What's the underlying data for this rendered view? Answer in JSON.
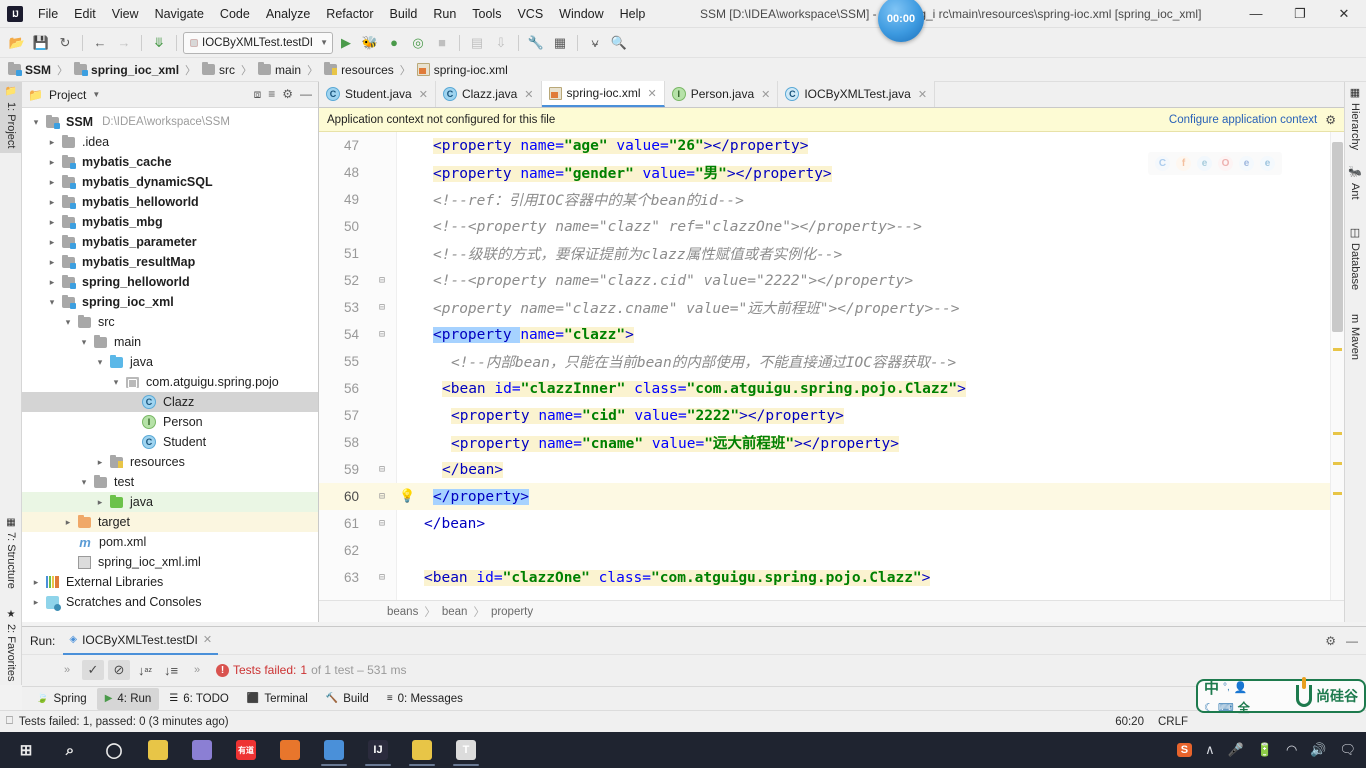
{
  "titlebar": {
    "app_icon": "intellij-idea-logo",
    "title": "SSM [D:\\IDEA\\workspace\\SSM] - ...\\spring_i     rc\\main\\resources\\spring-ioc.xml [spring_ioc_xml]",
    "timer_badge": "00:00",
    "menus": [
      "File",
      "Edit",
      "View",
      "Navigate",
      "Code",
      "Analyze",
      "Refactor",
      "Build",
      "Run",
      "Tools",
      "VCS",
      "Window",
      "Help"
    ],
    "window_buttons": {
      "minimize": "—",
      "maximize": "❐",
      "close": "✕"
    }
  },
  "toolbar": {
    "run_config": "IOCByXMLTest.testDI",
    "icons": [
      "open-folder-icon",
      "save-icon",
      "sync-icon",
      "back-arrow-icon",
      "forward-arrow-icon",
      "undo-icon",
      "run-icon",
      "debug-icon",
      "run-coverage-icon",
      "profile-icon",
      "stop-icon",
      "build-icon",
      "build-download-icon",
      "settings-wrench-icon",
      "project-structure-icon",
      "terminal-icon",
      "search-icon"
    ]
  },
  "navbar": {
    "crumbs": [
      {
        "label": "SSM",
        "icon": "module-folder-icon",
        "bold": true
      },
      {
        "label": "spring_ioc_xml",
        "icon": "module-folder-icon",
        "bold": true
      },
      {
        "label": "src",
        "icon": "folder-icon",
        "bold": false
      },
      {
        "label": "main",
        "icon": "folder-icon",
        "bold": false
      },
      {
        "label": "resources",
        "icon": "resources-folder-icon",
        "bold": false
      },
      {
        "label": "spring-ioc.xml",
        "icon": "xml-file-icon",
        "bold": false
      }
    ]
  },
  "left_strip": {
    "tabs": [
      {
        "label": "1: Project",
        "icon": "project-icon",
        "active": true
      },
      {
        "label": "7: Structure",
        "icon": "structure-icon",
        "active": false
      },
      {
        "label": "2: Favorites",
        "icon": "star-icon",
        "active": false
      }
    ]
  },
  "right_strip": {
    "tabs": [
      {
        "label": "Hierarchy",
        "icon": "hierarchy-icon"
      },
      {
        "label": "Ant",
        "icon": "ant-icon"
      },
      {
        "label": "Database",
        "icon": "database-icon"
      },
      {
        "label": "Maven",
        "icon": "maven-icon"
      }
    ]
  },
  "project_panel": {
    "title": "Project",
    "header_icons": [
      "collapse-all-icon",
      "expand-icon",
      "settings-gear-icon",
      "hide-icon"
    ],
    "tree": [
      {
        "label": "SSM",
        "path": "D:\\IDEA\\workspace\\SSM",
        "indent": 0,
        "arrow": "down",
        "icon": "module-folder-icon",
        "bold": true,
        "state": ""
      },
      {
        "label": ".idea",
        "indent": 1,
        "arrow": "right",
        "icon": "folder-icon",
        "bold": false,
        "state": ""
      },
      {
        "label": "mybatis_cache",
        "indent": 1,
        "arrow": "right",
        "icon": "module-folder-icon",
        "bold": true,
        "state": ""
      },
      {
        "label": "mybatis_dynamicSQL",
        "indent": 1,
        "arrow": "right",
        "icon": "module-folder-icon",
        "bold": true,
        "state": ""
      },
      {
        "label": "mybatis_helloworld",
        "indent": 1,
        "arrow": "right",
        "icon": "module-folder-icon",
        "bold": true,
        "state": ""
      },
      {
        "label": "mybatis_mbg",
        "indent": 1,
        "arrow": "right",
        "icon": "module-folder-icon",
        "bold": true,
        "state": ""
      },
      {
        "label": "mybatis_parameter",
        "indent": 1,
        "arrow": "right",
        "icon": "module-folder-icon",
        "bold": true,
        "state": ""
      },
      {
        "label": "mybatis_resultMap",
        "indent": 1,
        "arrow": "right",
        "icon": "module-folder-icon",
        "bold": true,
        "state": ""
      },
      {
        "label": "spring_helloworld",
        "indent": 1,
        "arrow": "right",
        "icon": "module-folder-icon",
        "bold": true,
        "state": ""
      },
      {
        "label": "spring_ioc_xml",
        "indent": 1,
        "arrow": "down",
        "icon": "module-folder-icon",
        "bold": true,
        "state": ""
      },
      {
        "label": "src",
        "indent": 2,
        "arrow": "down",
        "icon": "folder-icon",
        "bold": false,
        "state": ""
      },
      {
        "label": "main",
        "indent": 3,
        "arrow": "down",
        "icon": "folder-icon",
        "bold": false,
        "state": ""
      },
      {
        "label": "java",
        "indent": 4,
        "arrow": "down",
        "icon": "source-folder-icon",
        "bold": false,
        "state": ""
      },
      {
        "label": "com.atguigu.spring.pojo",
        "indent": 5,
        "arrow": "down",
        "icon": "package-icon",
        "bold": false,
        "state": ""
      },
      {
        "label": "Clazz",
        "indent": 6,
        "arrow": "none",
        "icon": "java-class-icon",
        "bold": false,
        "state": "selected"
      },
      {
        "label": "Person",
        "indent": 6,
        "arrow": "none",
        "icon": "java-interface-icon",
        "bold": false,
        "state": ""
      },
      {
        "label": "Student",
        "indent": 6,
        "arrow": "none",
        "icon": "java-class-icon",
        "bold": false,
        "state": ""
      },
      {
        "label": "resources",
        "indent": 4,
        "arrow": "right",
        "icon": "resources-folder-icon",
        "bold": false,
        "state": ""
      },
      {
        "label": "test",
        "indent": 3,
        "arrow": "down",
        "icon": "folder-icon",
        "bold": false,
        "state": ""
      },
      {
        "label": "java",
        "indent": 4,
        "arrow": "right",
        "icon": "test-source-folder-icon",
        "bold": false,
        "state": "green"
      },
      {
        "label": "target",
        "indent": 2,
        "arrow": "right",
        "icon": "target-folder-icon",
        "bold": false,
        "state": "yellow"
      },
      {
        "label": "pom.xml",
        "indent": 2,
        "arrow": "none",
        "icon": "maven-pom-icon",
        "bold": false,
        "state": ""
      },
      {
        "label": "spring_ioc_xml.iml",
        "indent": 2,
        "arrow": "none",
        "icon": "iml-file-icon",
        "bold": false,
        "state": ""
      },
      {
        "label": "External Libraries",
        "indent": 0,
        "arrow": "right",
        "icon": "libraries-icon",
        "bold": false,
        "state": ""
      },
      {
        "label": "Scratches and Consoles",
        "indent": 0,
        "arrow": "right",
        "icon": "scratches-icon",
        "bold": false,
        "state": ""
      }
    ]
  },
  "editor": {
    "tabs": [
      {
        "label": "Student.java",
        "icon": "java-class-icon",
        "active": false
      },
      {
        "label": "Clazz.java",
        "icon": "java-class-icon",
        "active": false
      },
      {
        "label": "spring-ioc.xml",
        "icon": "spring-xml-icon",
        "active": true
      },
      {
        "label": "Person.java",
        "icon": "java-interface-icon",
        "active": false
      },
      {
        "label": "IOCByXMLTest.java",
        "icon": "java-test-class-icon",
        "active": false
      }
    ],
    "notification": {
      "message": "Application context not configured for this file",
      "link": "Configure application context",
      "gear": "gear-icon"
    },
    "browser_previews": [
      "chrome-icon",
      "firefox-icon",
      "explorer-icon",
      "opera-icon",
      "edge-legacy-icon",
      "edge-icon"
    ],
    "breadcrumb": [
      "beans",
      "bean",
      "property"
    ],
    "current_line": 60,
    "lines": [
      {
        "n": 47,
        "fold": "",
        "cur": false,
        "indent": 4,
        "parts": [
          {
            "t": "<property ",
            "c": "tg",
            "h": true
          },
          {
            "t": "name=",
            "c": "at",
            "h": true
          },
          {
            "t": "\"age\"",
            "c": "vl",
            "h": true
          },
          {
            "t": " ",
            "c": "tg",
            "h": true
          },
          {
            "t": "value=",
            "c": "at",
            "h": true
          },
          {
            "t": "\"26\"",
            "c": "vl",
            "h": true
          },
          {
            "t": "></property>",
            "c": "tg",
            "h": true
          }
        ]
      },
      {
        "n": 48,
        "fold": "",
        "cur": false,
        "indent": 4,
        "parts": [
          {
            "t": "<property ",
            "c": "tg",
            "h": true
          },
          {
            "t": "name=",
            "c": "at",
            "h": true
          },
          {
            "t": "\"gender\"",
            "c": "vl",
            "h": true
          },
          {
            "t": " ",
            "c": "tg",
            "h": true
          },
          {
            "t": "value=",
            "c": "at",
            "h": true
          },
          {
            "t": "\"男\"",
            "c": "vl",
            "h": true
          },
          {
            "t": "></property>",
            "c": "tg",
            "h": true
          }
        ]
      },
      {
        "n": 49,
        "fold": "",
        "cur": false,
        "indent": 4,
        "parts": [
          {
            "t": "<!--ref：引用IOC容器中的某个bean的id-->",
            "c": "cm",
            "h": false
          }
        ]
      },
      {
        "n": 50,
        "fold": "",
        "cur": false,
        "indent": 4,
        "parts": [
          {
            "t": "<!--<property name=\"clazz\" ref=\"clazzOne\"></property>-->",
            "c": "cm",
            "h": false
          }
        ]
      },
      {
        "n": 51,
        "fold": "",
        "cur": false,
        "indent": 4,
        "parts": [
          {
            "t": "<!--级联的方式，要保证提前为clazz属性赋值或者实例化-->",
            "c": "cm",
            "h": false
          }
        ]
      },
      {
        "n": 52,
        "fold": "minus",
        "cur": false,
        "indent": 4,
        "parts": [
          {
            "t": "<!--<property name=\"clazz.cid\" value=\"2222\"></property>",
            "c": "cm",
            "h": false
          }
        ]
      },
      {
        "n": 53,
        "fold": "minus",
        "cur": false,
        "indent": 4,
        "parts": [
          {
            "t": "<property name=\"clazz.cname\" value=\"远大前程班\"></property>-->",
            "c": "cm",
            "h": false
          }
        ]
      },
      {
        "n": 54,
        "fold": "minus",
        "cur": false,
        "indent": 4,
        "parts": [
          {
            "t": "<property ",
            "c": "tg",
            "sel": true
          },
          {
            "t": "name=",
            "c": "at",
            "h": true
          },
          {
            "t": "\"clazz\"",
            "c": "vl",
            "h": true
          },
          {
            "t": ">",
            "c": "tg",
            "h": true
          }
        ]
      },
      {
        "n": 55,
        "fold": "",
        "cur": false,
        "indent": 6,
        "parts": [
          {
            "t": "<!--内部bean，只能在当前bean的内部使用，不能直接通过IOC容器获取-->",
            "c": "cm",
            "h": false
          }
        ]
      },
      {
        "n": 56,
        "fold": "",
        "cur": false,
        "indent": 5,
        "parts": [
          {
            "t": "<bean ",
            "c": "tg",
            "h": true
          },
          {
            "t": "id=",
            "c": "at",
            "h": true
          },
          {
            "t": "\"clazzInner\"",
            "c": "vl",
            "h": true
          },
          {
            "t": " ",
            "c": "tg",
            "h": true
          },
          {
            "t": "class=",
            "c": "at",
            "h": true
          },
          {
            "t": "\"com.atguigu.spring.pojo.Clazz\"",
            "c": "vl",
            "h": true
          },
          {
            "t": ">",
            "c": "tg",
            "h": true
          }
        ]
      },
      {
        "n": 57,
        "fold": "",
        "cur": false,
        "indent": 6,
        "parts": [
          {
            "t": "<property ",
            "c": "tg",
            "h": true
          },
          {
            "t": "name=",
            "c": "at",
            "h": true
          },
          {
            "t": "\"cid\"",
            "c": "vl",
            "h": true
          },
          {
            "t": " ",
            "c": "tg",
            "h": true
          },
          {
            "t": "value=",
            "c": "at",
            "h": true
          },
          {
            "t": "\"2222\"",
            "c": "vl",
            "h": true
          },
          {
            "t": "></property>",
            "c": "tg",
            "h": true
          }
        ]
      },
      {
        "n": 58,
        "fold": "",
        "cur": false,
        "indent": 6,
        "parts": [
          {
            "t": "<property ",
            "c": "tg",
            "h": true
          },
          {
            "t": "name=",
            "c": "at",
            "h": true
          },
          {
            "t": "\"cname\"",
            "c": "vl",
            "h": true
          },
          {
            "t": " ",
            "c": "tg",
            "h": true
          },
          {
            "t": "value=",
            "c": "at",
            "h": true
          },
          {
            "t": "\"远大前程班\"",
            "c": "vl",
            "h": true
          },
          {
            "t": "></property>",
            "c": "tg",
            "h": true
          }
        ]
      },
      {
        "n": 59,
        "fold": "minus",
        "cur": false,
        "indent": 5,
        "parts": [
          {
            "t": "</bean>",
            "c": "tg",
            "h": true
          }
        ]
      },
      {
        "n": 60,
        "fold": "minus",
        "cur": true,
        "indent": 4,
        "bulb": true,
        "parts": [
          {
            "t": "</property>",
            "c": "tg",
            "sel": true
          }
        ]
      },
      {
        "n": 61,
        "fold": "minus",
        "cur": false,
        "indent": 3,
        "parts": [
          {
            "t": "</bean>",
            "c": "tg",
            "h": false
          }
        ]
      },
      {
        "n": 62,
        "fold": "",
        "cur": false,
        "indent": 0,
        "parts": []
      },
      {
        "n": 63,
        "fold": "minus",
        "cur": false,
        "indent": 3,
        "parts": [
          {
            "t": "<bean ",
            "c": "tg",
            "h": true
          },
          {
            "t": "id=",
            "c": "at",
            "h": true
          },
          {
            "t": "\"clazzOne\"",
            "c": "vl",
            "h": true
          },
          {
            "t": " ",
            "c": "tg",
            "h": true
          },
          {
            "t": "class=",
            "c": "at",
            "h": true
          },
          {
            "t": "\"com.atguigu.spring.pojo.Clazz\"",
            "c": "vl",
            "h": true
          },
          {
            "t": ">",
            "c": "tg",
            "h": true
          }
        ]
      }
    ]
  },
  "run_panel": {
    "label": "Run:",
    "tab": "IOCByXMLTest.testDI",
    "toolbar_icons": [
      "show-passed-icon",
      "hide-ignored-icon",
      "sort-alphabetically-icon",
      "sort-by-duration-icon",
      "expand-more-icon"
    ],
    "status_prefix": "Tests failed:",
    "status_count": "1",
    "status_suffix": "of 1 test – 531 ms",
    "header_icons": [
      "settings-gear-icon",
      "hide-icon"
    ]
  },
  "bottom_tabs": [
    {
      "label": "Spring",
      "icon": "spring-leaf-icon",
      "active": false
    },
    {
      "label": "4: Run",
      "icon": "run-icon",
      "active": true
    },
    {
      "label": "6: TODO",
      "icon": "todo-icon",
      "active": false
    },
    {
      "label": "Terminal",
      "icon": "terminal-icon",
      "active": false
    },
    {
      "label": "Build",
      "icon": "build-hammer-icon",
      "active": false
    },
    {
      "label": "0: Messages",
      "icon": "messages-icon",
      "active": false
    }
  ],
  "statusbar": {
    "message": "Tests failed: 1, passed: 0 (3 minutes ago)",
    "position": "60:20",
    "line_separator": "CRLF"
  },
  "ime": {
    "mode": "中",
    "punct": "°,",
    "user": "user-icon",
    "moon": "moon-icon",
    "keyboard": "keyboard-icon",
    "full": "全",
    "brand": "尚硅谷"
  },
  "taskbar": {
    "apps": [
      {
        "name": "start-button-icon",
        "glyph": "⊞",
        "color": "#1f2430",
        "open": false
      },
      {
        "name": "search-icon",
        "glyph": "⌕",
        "color": "#1f2430",
        "open": false
      },
      {
        "name": "cortana-icon",
        "glyph": "◯",
        "color": "#1f2430",
        "open": false
      },
      {
        "name": "navicat-icon",
        "glyph": "",
        "color": "#e8c547",
        "open": false
      },
      {
        "name": "dolphin-icon",
        "glyph": "",
        "color": "#8b7fd4",
        "open": false
      },
      {
        "name": "youdao-icon",
        "glyph": "有道",
        "color": "#e33",
        "open": false
      },
      {
        "name": "firefox-icon",
        "glyph": "",
        "color": "#e8762c",
        "open": false
      },
      {
        "name": "chrome-icon",
        "glyph": "",
        "color": "#4a90d9",
        "open": true
      },
      {
        "name": "intellij-idea-icon",
        "glyph": "IJ",
        "color": "#2b2b3d",
        "open": true
      },
      {
        "name": "file-explorer-icon",
        "glyph": "",
        "color": "#e8c547",
        "open": true
      },
      {
        "name": "text-editor-icon",
        "glyph": "T",
        "color": "#dcdcdc",
        "open": true
      }
    ],
    "tray": [
      "sogou-icon",
      "show-hidden-icons-icon",
      "microphone-icon",
      "battery-icon",
      "wifi-icon",
      "volume-icon",
      "action-center-icon"
    ]
  }
}
